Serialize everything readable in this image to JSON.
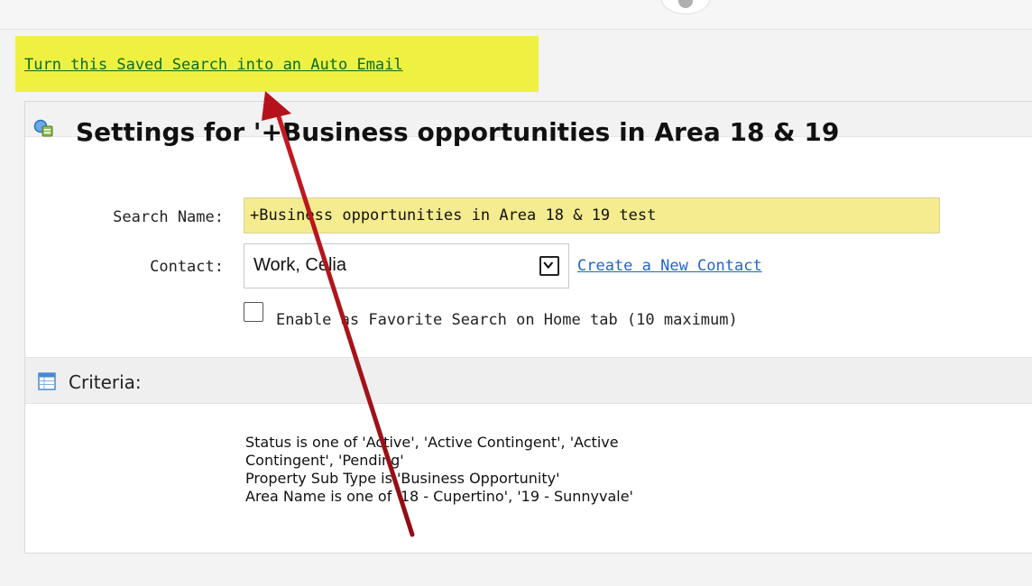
{
  "auto_email": {
    "link_text": "Turn this Saved Search into an Auto Email"
  },
  "settings": {
    "title": "Settings for '+Business opportunities in Area 18 & 19",
    "search_name": {
      "label": "Search Name:",
      "value": "+Business opportunities in Area 18 & 19 test"
    },
    "contact": {
      "label": "Contact:",
      "value": "Work, Celia",
      "create_link": "Create a New Contact"
    },
    "favorite": {
      "label": "Enable as Favorite Search on Home tab (10 maximum)",
      "checked": false
    }
  },
  "criteria": {
    "label": "Criteria:",
    "lines": [
      "Status is one of 'Active', 'Active Contingent', 'Active",
      "Contingent', 'Pending'",
      "Property Sub Type is 'Business Opportunity'",
      "Area Name is one of '18 - Cupertino', '19 - Sunnyvale'"
    ]
  },
  "colors": {
    "highlight": "#eef141",
    "link_green": "#0e6a1e",
    "link_blue": "#1f66c7",
    "input_highlight": "#f5ec8f",
    "arrow": "#b5121b"
  },
  "icons": {
    "title": "saved-search-settings-icon",
    "criteria": "table-icon",
    "select": "chevron-down-icon"
  }
}
